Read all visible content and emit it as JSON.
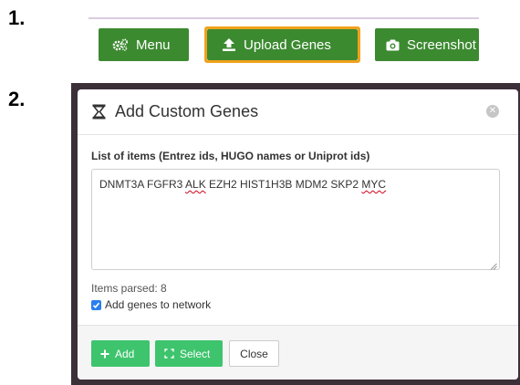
{
  "steps": {
    "one": "1.",
    "two": "2."
  },
  "toolbar": {
    "menu_label": "Menu",
    "upload_label": "Upload Genes",
    "screenshot_label": "Screenshot"
  },
  "modal": {
    "title": "Add Custom Genes",
    "list_label": "List of items (Entrez ids, HUGO names or Uniprot ids)",
    "genes": {
      "before": "DNMT3A FGFR3 ",
      "alk": "ALK",
      "middle": " EZH2 HIST1H3B MDM2 SKP2 ",
      "myc": "MYC"
    },
    "items_parsed": "Items parsed: 8",
    "checkbox_label": "Add genes to network",
    "checkbox_checked": true,
    "buttons": {
      "add": "Add",
      "select": "Select",
      "close": "Close"
    }
  },
  "colors": {
    "toolbar_green": "#3c8a30",
    "highlight_orange": "#f1a11d",
    "modal_green": "#3ec46d",
    "checkbox_blue": "#2a7ef0"
  },
  "icons": [
    "cogs-icon",
    "upload-icon",
    "camera-icon",
    "hourglass-icon",
    "close-icon",
    "plus-icon",
    "select-icon",
    "checkmark-icon"
  ]
}
